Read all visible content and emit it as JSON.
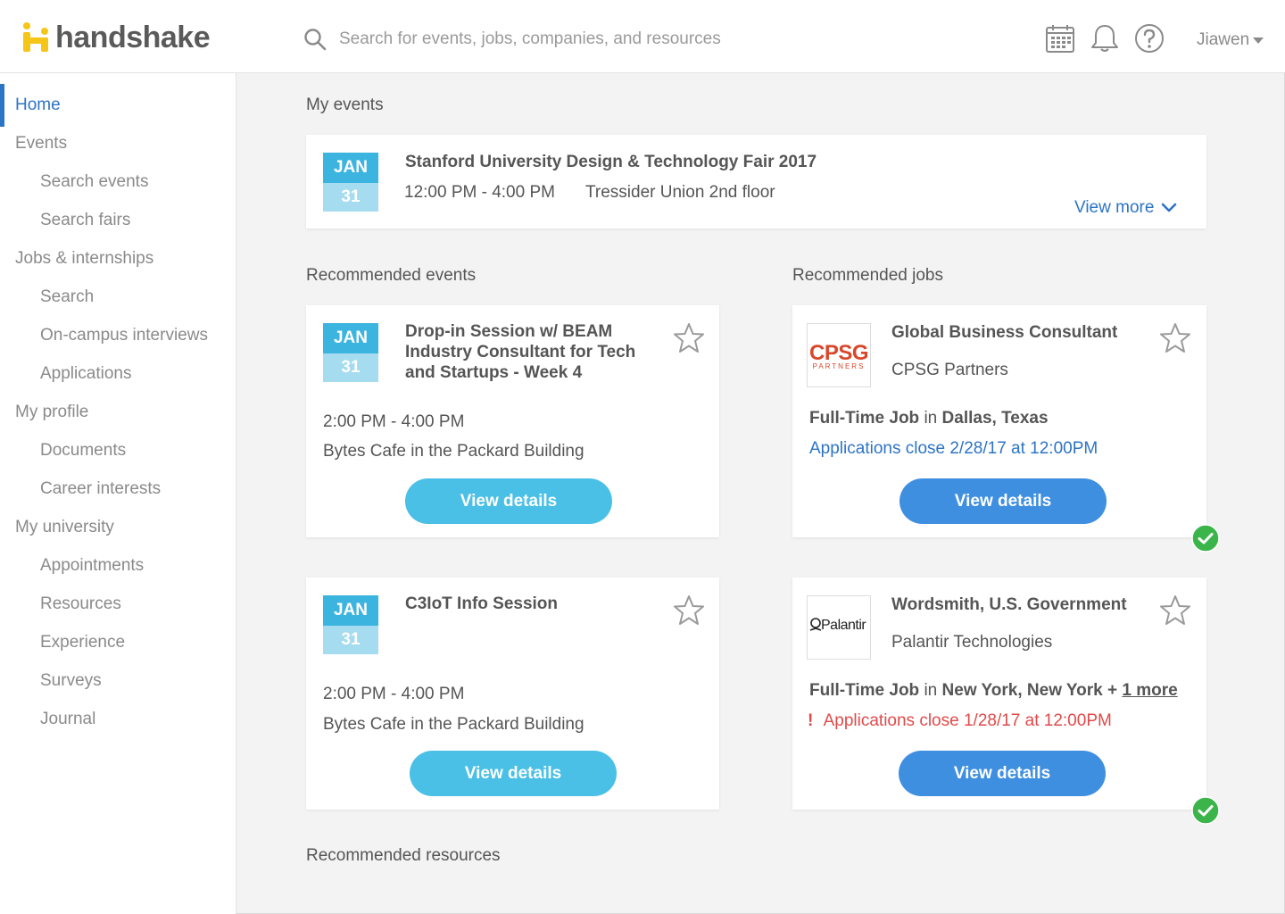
{
  "header": {
    "logo_text": "handshake",
    "search_placeholder": "Search for events, jobs, companies, and resources",
    "user_name": "Jiawen"
  },
  "sidebar": {
    "items": [
      {
        "label": "Home"
      },
      {
        "label": "Events"
      },
      {
        "label": "Search events"
      },
      {
        "label": "Search fairs"
      },
      {
        "label": "Jobs & internships"
      },
      {
        "label": "Search"
      },
      {
        "label": "On-campus interviews"
      },
      {
        "label": "Applications"
      },
      {
        "label": "My profile"
      },
      {
        "label": "Documents"
      },
      {
        "label": "Career interests"
      },
      {
        "label": "My university"
      },
      {
        "label": "Appointments"
      },
      {
        "label": "Resources"
      },
      {
        "label": "Experience"
      },
      {
        "label": "Surveys"
      },
      {
        "label": "Journal"
      }
    ]
  },
  "my_events": {
    "title": "My events",
    "event": {
      "month": "JAN",
      "day": "31",
      "name": "Stanford University Design & Technology Fair 2017",
      "time": "12:00 PM - 4:00 PM",
      "location": "Tressider Union 2nd floor"
    },
    "view_more": "View more"
  },
  "recommended_events": {
    "title": "Recommended events",
    "items": [
      {
        "month": "JAN",
        "day": "31",
        "name": "Drop-in Session w/ BEAM Industry Consultant for Tech and Startups - Week 4",
        "time": "2:00 PM - 4:00 PM",
        "location": "Bytes Cafe in the Packard Building",
        "button": "View details"
      },
      {
        "month": "JAN",
        "day": "31",
        "name": "C3IoT Info Session",
        "time": "2:00 PM - 4:00 PM",
        "location": "Bytes Cafe in the Packard Building",
        "button": "View details"
      }
    ]
  },
  "recommended_jobs": {
    "title": "Recommended jobs",
    "items": [
      {
        "logo_text": "CPSG",
        "logo_sub": "PARTNERS",
        "title": "Global Business Consultant",
        "company": "CPSG Partners",
        "job_type": "Full-Time Job",
        "in": "in",
        "location": "Dallas, Texas",
        "deadline": "Applications close 2/28/17 at 12:00PM",
        "button": "View details"
      },
      {
        "logo_text": "Palantir",
        "title": "Wordsmith, U.S. Government",
        "company": "Palantir Technologies",
        "job_type": "Full-Time Job",
        "in": "in",
        "location": "New York, New York +",
        "more": "1 more",
        "warn_mark": "!",
        "deadline": "Applications close 1/28/17 at 12:00PM",
        "button": "View details"
      }
    ]
  },
  "recommended_resources": {
    "title": "Recommended resources"
  },
  "colors": {
    "accent": "#2c74c6",
    "event_button": "#4ac0e6",
    "job_button": "#3f8fe0",
    "date_month": "#3cb4e0",
    "date_day": "#a6dcf0",
    "check": "#3bb54a",
    "warning": "#e14a4a",
    "logo_yellow": "#f5c518"
  }
}
